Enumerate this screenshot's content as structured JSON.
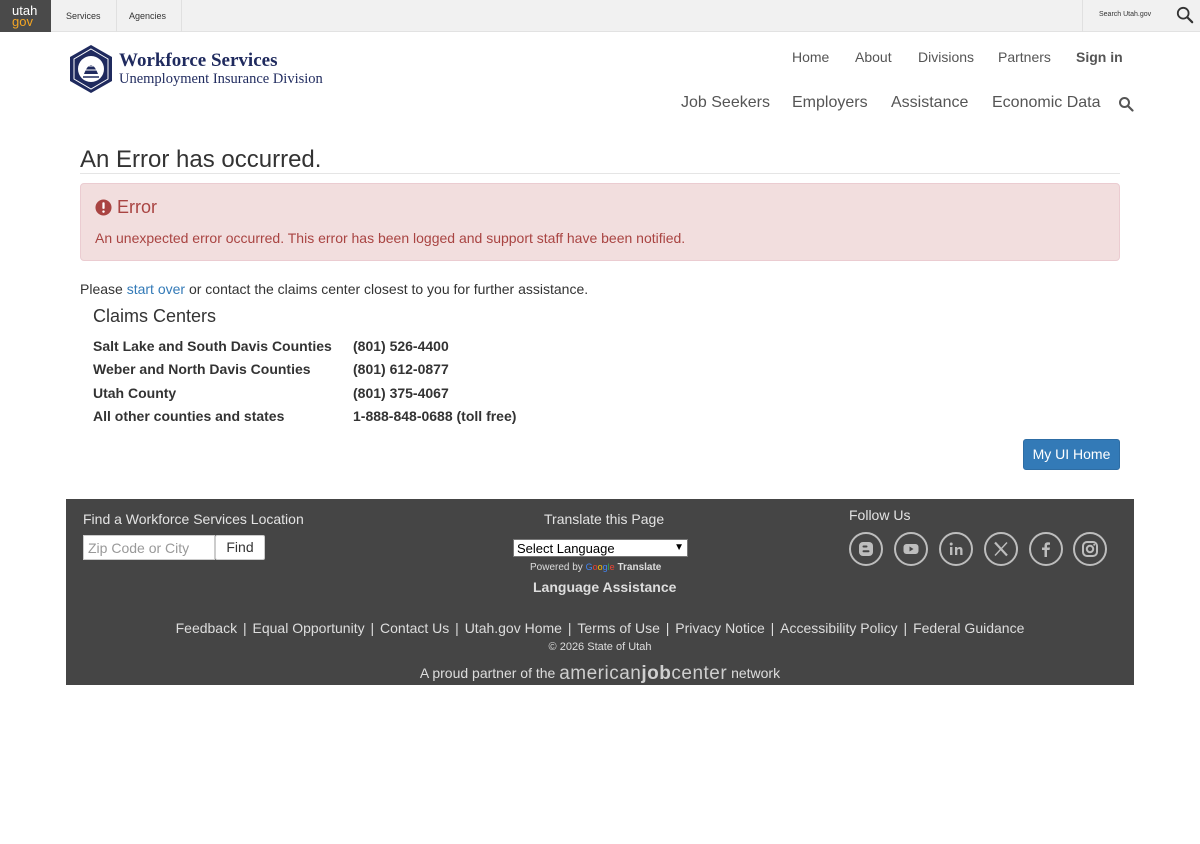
{
  "utah_bar": {
    "logo_top": "utah",
    "logo_bottom": "gov",
    "services": "Services",
    "agencies": "Agencies",
    "search_label": "Search Utah.gov"
  },
  "header": {
    "brand_title": "Workforce Services",
    "brand_subtitle": "Unemployment Insurance Division",
    "top_nav": [
      "Home",
      "About",
      "Divisions",
      "Partners",
      "Sign in"
    ],
    "main_nav": [
      "Job Seekers",
      "Employers",
      "Assistance",
      "Economic Data"
    ]
  },
  "content": {
    "page_title": "An Error has occurred.",
    "alert_heading": "Error",
    "alert_message": "An unexpected error occurred. This error has been logged and support staff have been notified.",
    "lead_before": "Please ",
    "lead_link": "start over",
    "lead_after": " or contact the claims center closest to you for further assistance.",
    "centers_title": "Claims Centers",
    "centers": [
      {
        "name": "Salt Lake and South Davis Counties",
        "phone": "(801) 526-4400"
      },
      {
        "name": "Weber and North Davis Counties",
        "phone": "(801) 612-0877"
      },
      {
        "name": "Utah County",
        "phone": "(801) 375-4067"
      },
      {
        "name": "All other counties and states",
        "phone": "1-888-848-0688 (toll free)"
      }
    ],
    "home_button": "My UI Home"
  },
  "footer": {
    "location_title": "Find a Workforce Services Location",
    "location_placeholder": "Zip Code or City",
    "find_button": "Find",
    "translate_title": "Translate this Page",
    "select_language": "Select Language",
    "powered_by": "Powered by ",
    "google": "Google",
    "translate": " Translate",
    "language_assistance": "Language Assistance",
    "follow_us": "Follow Us",
    "social": [
      "blogger-icon",
      "youtube-icon",
      "linkedin-icon",
      "x-icon",
      "facebook-icon",
      "instagram-icon"
    ],
    "links": [
      "Feedback",
      "Equal Opportunity",
      "Contact Us",
      "Utah.gov Home",
      "Terms of Use",
      "Privacy Notice",
      "Accessibility Policy",
      "Federal Guidance"
    ],
    "link_separator": " | ",
    "copyright": "© 2026 State of Utah",
    "partner_before": "A proud partner of the ",
    "partner_brand_a": "american",
    "partner_brand_b": "job",
    "partner_brand_c": "center",
    "partner_after": " network"
  },
  "colors": {
    "brand_navy": "#1f2a5e",
    "error_bg": "#f2dede",
    "error_text": "#a94442",
    "primary_button": "#337ab7",
    "footer_bg": "#454545"
  }
}
